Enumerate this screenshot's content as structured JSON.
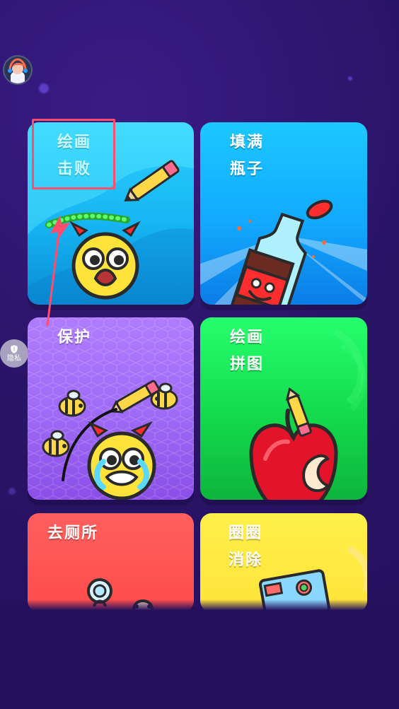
{
  "ui": {
    "privacy_label": "隐私",
    "cards": [
      {
        "title": "绘画\n击败",
        "color_top": "#2fd1ff"
      },
      {
        "title": "填满\n瓶子",
        "color_top": "#1cc8ff"
      },
      {
        "title": "保护",
        "color_top": "#b07cff"
      },
      {
        "title": "绘画\n拼图",
        "color_top": "#26ff6e"
      },
      {
        "title": "去厕所",
        "color_top": "#ff5f5f"
      },
      {
        "title": "圈圈\n消除",
        "color_top": "#fff04a"
      }
    ],
    "accent_highlight": "#ff4d6d"
  },
  "icons": {
    "avatar": "avatar-icon",
    "privacy": "shield-icon",
    "pencil": "pencil-icon",
    "bee": "bee-icon",
    "bottle": "bottle-icon",
    "apple": "apple-icon"
  }
}
